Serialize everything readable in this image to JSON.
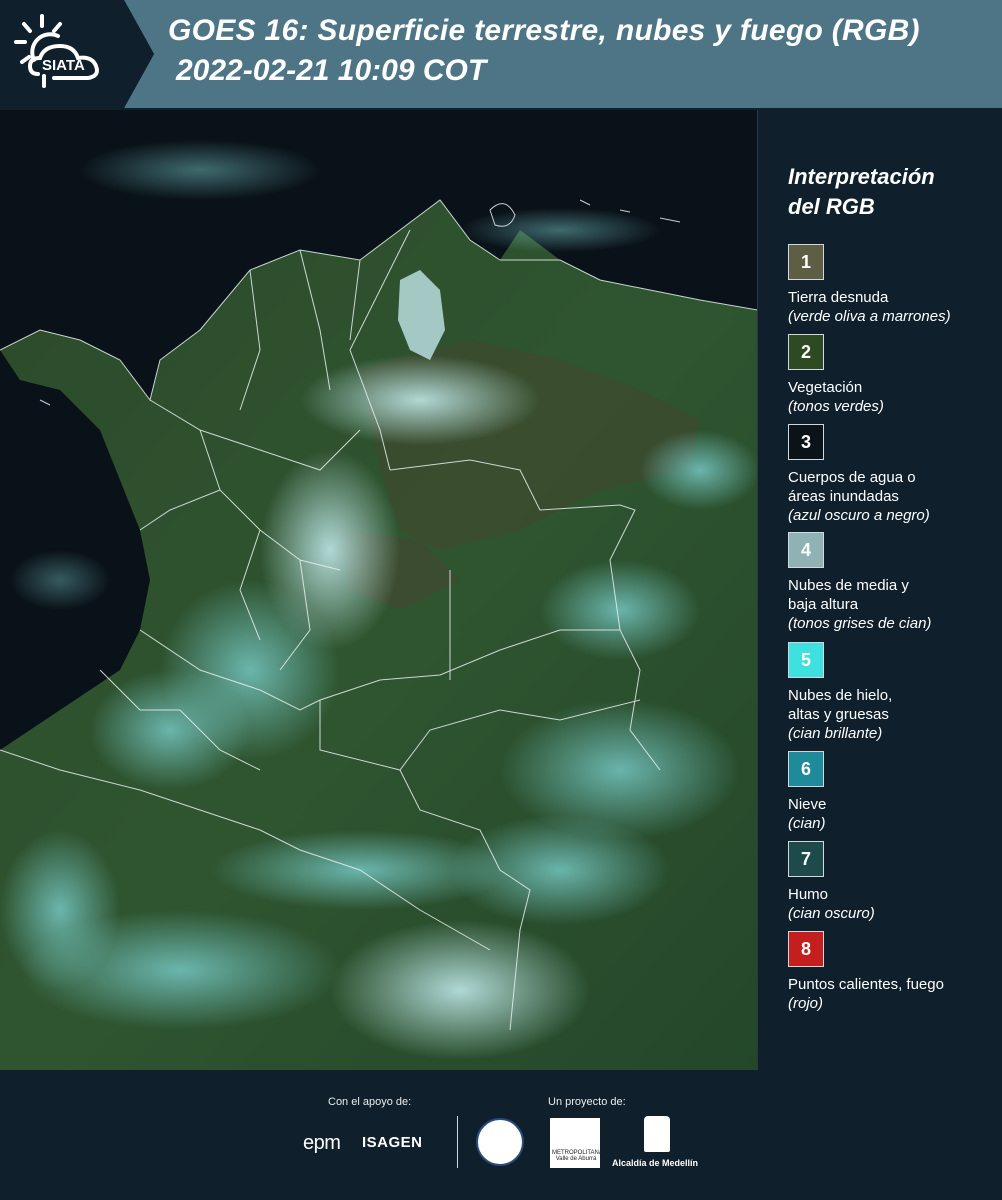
{
  "header": {
    "logo_text": "SIATA",
    "title": "GOES 16: Superficie terrestre, nubes y fuego (RGB)",
    "datetime": "2022-02-21 10:09 COT"
  },
  "legend": {
    "title_line1": "Interpretación",
    "title_line2": "del RGB",
    "items": [
      {
        "num": "1",
        "color": "#5e5e44",
        "label": "Tierra desnuda",
        "desc": "(verde oliva a marrones)"
      },
      {
        "num": "2",
        "color": "#2f4a22",
        "label": "Vegetación",
        "desc": "(tonos verdes)"
      },
      {
        "num": "3",
        "color": "#0b1218",
        "label": "Cuerpos de agua o áreas inundadas",
        "desc": "(azul oscuro a negro)"
      },
      {
        "num": "4",
        "color": "#8fb3b4",
        "label": "Nubes de media y baja altura",
        "desc": "(tonos grises de cian)"
      },
      {
        "num": "5",
        "color": "#3fe0e0",
        "label": "Nubes de hielo, altas y gruesas",
        "desc": "(cian brillante)"
      },
      {
        "num": "6",
        "color": "#1f8a9a",
        "label": "Nieve",
        "desc": "(cian)"
      },
      {
        "num": "7",
        "color": "#1e4a4c",
        "label": "Humo",
        "desc": "(cian oscuro)"
      },
      {
        "num": "8",
        "color": "#c41e1e",
        "label": "Puntos calientes, fuego",
        "desc": "(rojo)"
      }
    ]
  },
  "footer": {
    "support_label": "Con el apoyo de:",
    "project_label": "Un proyecto de:",
    "epm": "epm",
    "isagen": "ISAGEN",
    "amva_line1": "METROPOLITANA",
    "amva_line2": "Valle de Aburrá",
    "alcaldia": "Alcaldía de Medellín"
  }
}
